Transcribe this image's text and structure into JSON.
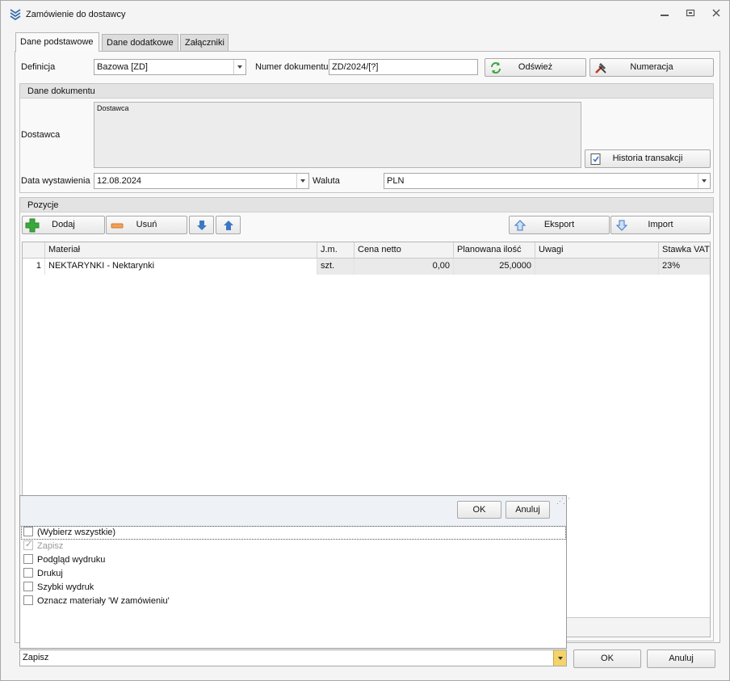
{
  "window": {
    "title": "Zamówienie do dostawcy"
  },
  "tabs": [
    {
      "label": "Dane podstawowe"
    },
    {
      "label": "Dane dodatkowe"
    },
    {
      "label": "Załączniki"
    }
  ],
  "header": {
    "definicja_label": "Definicja",
    "definicja_value": "Bazowa [ZD]",
    "numer_label": "Numer dokumentu",
    "numer_value": "ZD/2024/[?]",
    "odswiez_label": "Odśwież",
    "numeracja_label": "Numeracja"
  },
  "dane_dokumentu": {
    "title": "Dane dokumentu",
    "dostawca_label": "Dostawca",
    "dostawca_box_caption": "Dostawca",
    "historia_label": "Historia transakcji",
    "data_label": "Data wystawienia",
    "data_value": "12.08.2024",
    "waluta_label": "Waluta",
    "waluta_value": "PLN"
  },
  "pozycje": {
    "title": "Pozycje",
    "dodaj_label": "Dodaj",
    "usun_label": "Usuń",
    "eksport_label": "Eksport",
    "import_label": "Import",
    "columns": [
      "",
      "Materiał",
      "J.m.",
      "Cena netto",
      "Planowana ilość",
      "Uwagi",
      "Stawka VAT"
    ],
    "rows": [
      {
        "lp": "1",
        "material": "NEKTARYNKI - Nektarynki",
        "jm": "szt.",
        "cena": "0,00",
        "ilosc": "25,0000",
        "uwagi": "",
        "vat": "23%"
      }
    ]
  },
  "popup": {
    "ok_label": "OK",
    "anuluj_label": "Anuluj",
    "items": [
      {
        "label": "(Wybierz wszystkie)",
        "checked": false,
        "disabled": false
      },
      {
        "label": "Zapisz",
        "checked": true,
        "disabled": true
      },
      {
        "label": "Podgląd wydruku",
        "checked": false,
        "disabled": false
      },
      {
        "label": "Drukuj",
        "checked": false,
        "disabled": false
      },
      {
        "label": "Szybki wydruk",
        "checked": false,
        "disabled": false
      },
      {
        "label": "Oznacz materiały 'W zamówieniu'",
        "checked": false,
        "disabled": false
      }
    ]
  },
  "footer": {
    "action_value": "Zapisz",
    "ok_label": "OK",
    "anuluj_label": "Anuluj"
  },
  "colors": {
    "accent_green": "#3aa83a",
    "accent_blue": "#3d78c6",
    "dropdown_yellow": "#f3d36b"
  }
}
